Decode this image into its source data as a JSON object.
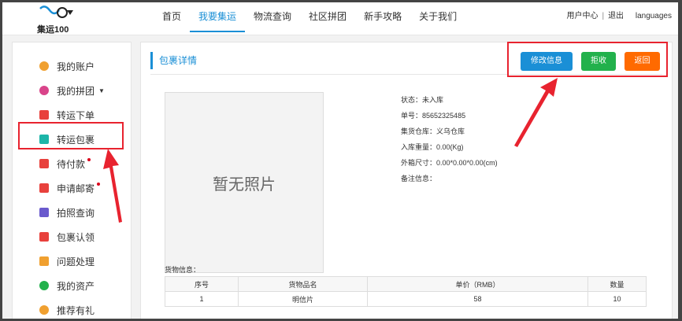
{
  "header": {
    "logo_text": "集运100",
    "nav": [
      {
        "label": "首页"
      },
      {
        "label": "我要集运"
      },
      {
        "label": "物流查询"
      },
      {
        "label": "社区拼团"
      },
      {
        "label": "新手攻略"
      },
      {
        "label": "关于我们"
      }
    ],
    "user_center": "用户中心",
    "separator": "|",
    "logout": "退出",
    "languages": "languages"
  },
  "sidebar": {
    "items": [
      {
        "label": "我的账户",
        "icon": "account-icon",
        "color": "#f0a030"
      },
      {
        "label": "我的拼团",
        "icon": "group-icon",
        "color": "#d9448a"
      },
      {
        "label": "转运下单",
        "icon": "order-icon",
        "color": "#e8413c"
      },
      {
        "label": "转运包裹",
        "icon": "package-icon",
        "color": "#1cb5a8"
      },
      {
        "label": "待付款",
        "icon": "payment-icon",
        "color": "#e8413c"
      },
      {
        "label": "申请邮寄",
        "icon": "mail-icon",
        "color": "#e8413c"
      },
      {
        "label": "拍照查询",
        "icon": "photo-icon",
        "color": "#6a5acd"
      },
      {
        "label": "包裹认领",
        "icon": "claim-icon",
        "color": "#e8413c"
      },
      {
        "label": "问题处理",
        "icon": "issue-icon",
        "color": "#f0a030"
      },
      {
        "label": "我的资产",
        "icon": "assets-icon",
        "color": "#22b14c"
      },
      {
        "label": "推荐有礼",
        "icon": "share-icon",
        "color": "#f0a030"
      }
    ]
  },
  "main": {
    "title": "包裹详情",
    "buttons": {
      "modify": "修改信息",
      "reject": "拒收",
      "back": "返回"
    },
    "photo_placeholder": "暂无照片",
    "info": [
      {
        "label": "状态：",
        "value": "未入库"
      },
      {
        "label": "单号：",
        "value": "85652325485"
      },
      {
        "label": "集货仓库：",
        "value": "义乌仓库"
      },
      {
        "label": "入库重量：",
        "value": "0.00(Kg)"
      },
      {
        "label": "外箱尺寸：",
        "value": "0.00*0.00*0.00(cm)"
      },
      {
        "label": "备注信息：",
        "value": ""
      }
    ],
    "goods_label": "货物信息：",
    "table": {
      "headers": [
        "序号",
        "货物品名",
        "单价（RMB）",
        "数量"
      ],
      "rows": [
        [
          "1",
          "明信片",
          "58",
          "10"
        ]
      ]
    }
  },
  "colors": {
    "accent": "#1a8fd6",
    "annotation": "#e8232f"
  }
}
